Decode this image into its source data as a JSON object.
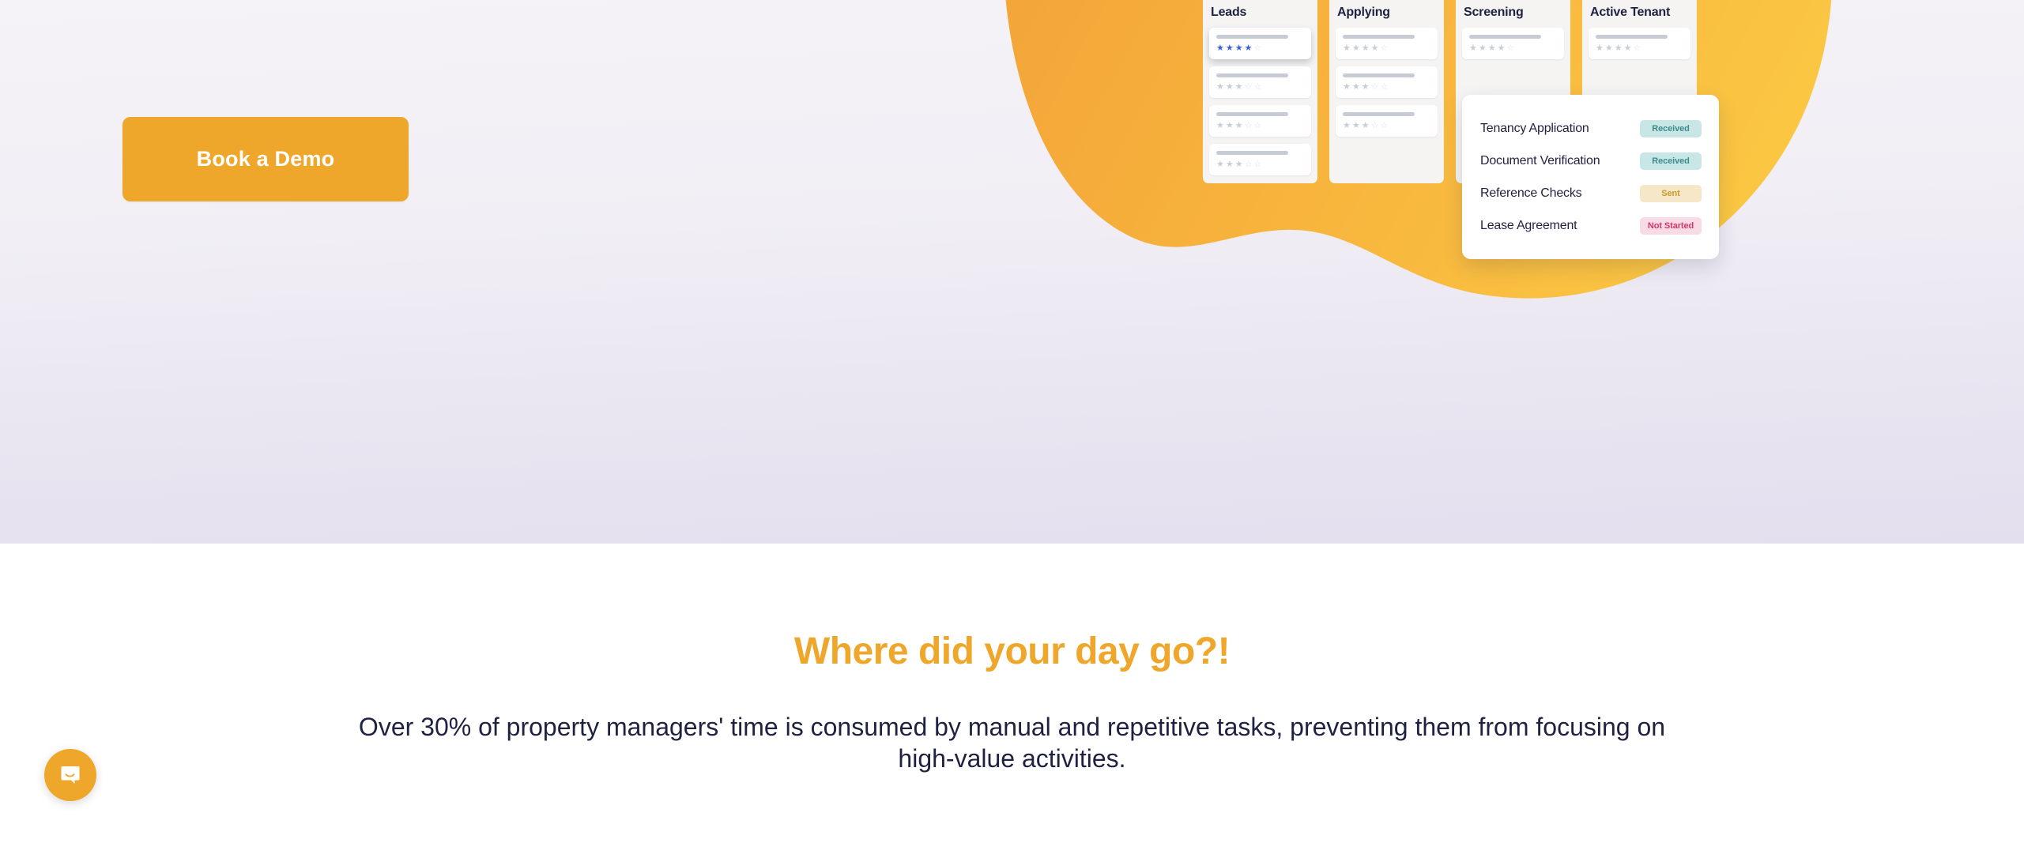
{
  "hero": {
    "cta": {
      "label": "Book a Demo",
      "color": "#EFA72B"
    },
    "blob": {
      "color_start": "#F5A93A",
      "color_end": "#FBC742"
    },
    "kanban": {
      "columns": [
        {
          "title": "Leads",
          "cards": [
            {
              "stars_filled": 4,
              "stars_total": 5,
              "highlighted": true
            },
            {
              "stars_filled": 3,
              "stars_total": 5,
              "highlighted": false
            },
            {
              "stars_filled": 3,
              "stars_total": 5,
              "highlighted": false
            },
            {
              "stars_filled": 3,
              "stars_total": 5,
              "highlighted": false
            }
          ]
        },
        {
          "title": "Applying",
          "cards": [
            {
              "stars_filled": 4,
              "stars_total": 5,
              "highlighted": false
            },
            {
              "stars_filled": 3,
              "stars_total": 5,
              "highlighted": false
            },
            {
              "stars_filled": 3,
              "stars_total": 5,
              "highlighted": false
            }
          ]
        },
        {
          "title": "Screening",
          "cards": [
            {
              "stars_filled": 4,
              "stars_total": 5,
              "highlighted": false
            }
          ]
        },
        {
          "title": "Active Tenant",
          "cards": [
            {
              "stars_filled": 4,
              "stars_total": 5,
              "highlighted": false
            }
          ]
        }
      ]
    },
    "checklist": {
      "rows": [
        {
          "label": "Tenancy Application",
          "status": "Received",
          "status_kind": "received"
        },
        {
          "label": "Document Verification",
          "status": "Received",
          "status_kind": "received"
        },
        {
          "label": "Reference Checks",
          "status": "Sent",
          "status_kind": "sent"
        },
        {
          "label": "Lease Agreement",
          "status": "Not Started",
          "status_kind": "not-started"
        }
      ],
      "status_colors": {
        "received_bg": "#C8E6E6",
        "received_fg": "#3C8C8C",
        "sent_bg": "#F6E7C9",
        "sent_fg": "#C99A2C",
        "not_started_bg": "#F8DBE4",
        "not_started_fg": "#D4376B"
      }
    }
  },
  "content": {
    "heading": "Where did your day go?!",
    "heading_color": "#EFA72B",
    "paragraph": "Over 30% of property managers' time is consumed by manual and repetitive tasks, preventing them from focusing on high-value activities."
  },
  "widgets": {
    "chat_launcher": {
      "icon": "chat-bubble-smile-icon",
      "color": "#EFA72B"
    }
  }
}
